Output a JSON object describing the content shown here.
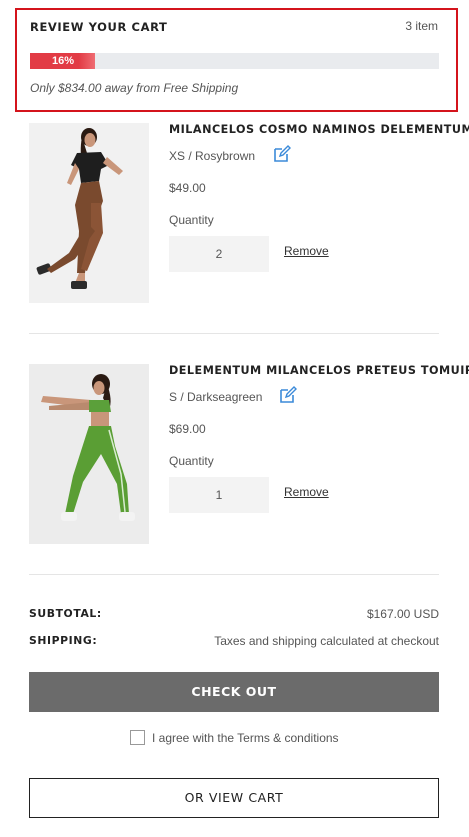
{
  "header": {
    "title": "REVIEW YOUR CART",
    "item_count": "3 item",
    "progress_label": "16%",
    "progress_fraction": 0.16,
    "free_shipping_text": "Only $834.00 away from Free Shipping"
  },
  "items": [
    {
      "name": "MILANCELOS COSMO NAMINOS DELEMENTUM",
      "variant": "XS / Rosybrown",
      "price": "$49.00",
      "quantity_label": "Quantity",
      "quantity": "2",
      "remove_label": "Remove"
    },
    {
      "name": "DELEMENTUM MILANCELOS PRETEUS TOMUIR",
      "variant": "S / Darkseagreen",
      "price": "$69.00",
      "quantity_label": "Quantity",
      "quantity": "1",
      "remove_label": "Remove"
    }
  ],
  "summary": {
    "subtotal_label": "SUBTOTAL:",
    "subtotal_value": "$167.00 USD",
    "shipping_label": "SHIPPING:",
    "shipping_value": "Taxes and shipping calculated at checkout"
  },
  "actions": {
    "checkout_label": "CHECK OUT",
    "terms_text": "I agree with the Terms & conditions",
    "view_cart_label": "OR VIEW CART"
  },
  "colors": {
    "accent_red": "#d4141c",
    "progress_red": "#e23b45",
    "edit_icon_blue": "#3b8ad9",
    "checkout_gray": "#6b6b6b"
  },
  "icons": {
    "edit": "edit-icon",
    "checkbox": "checkbox-icon"
  }
}
